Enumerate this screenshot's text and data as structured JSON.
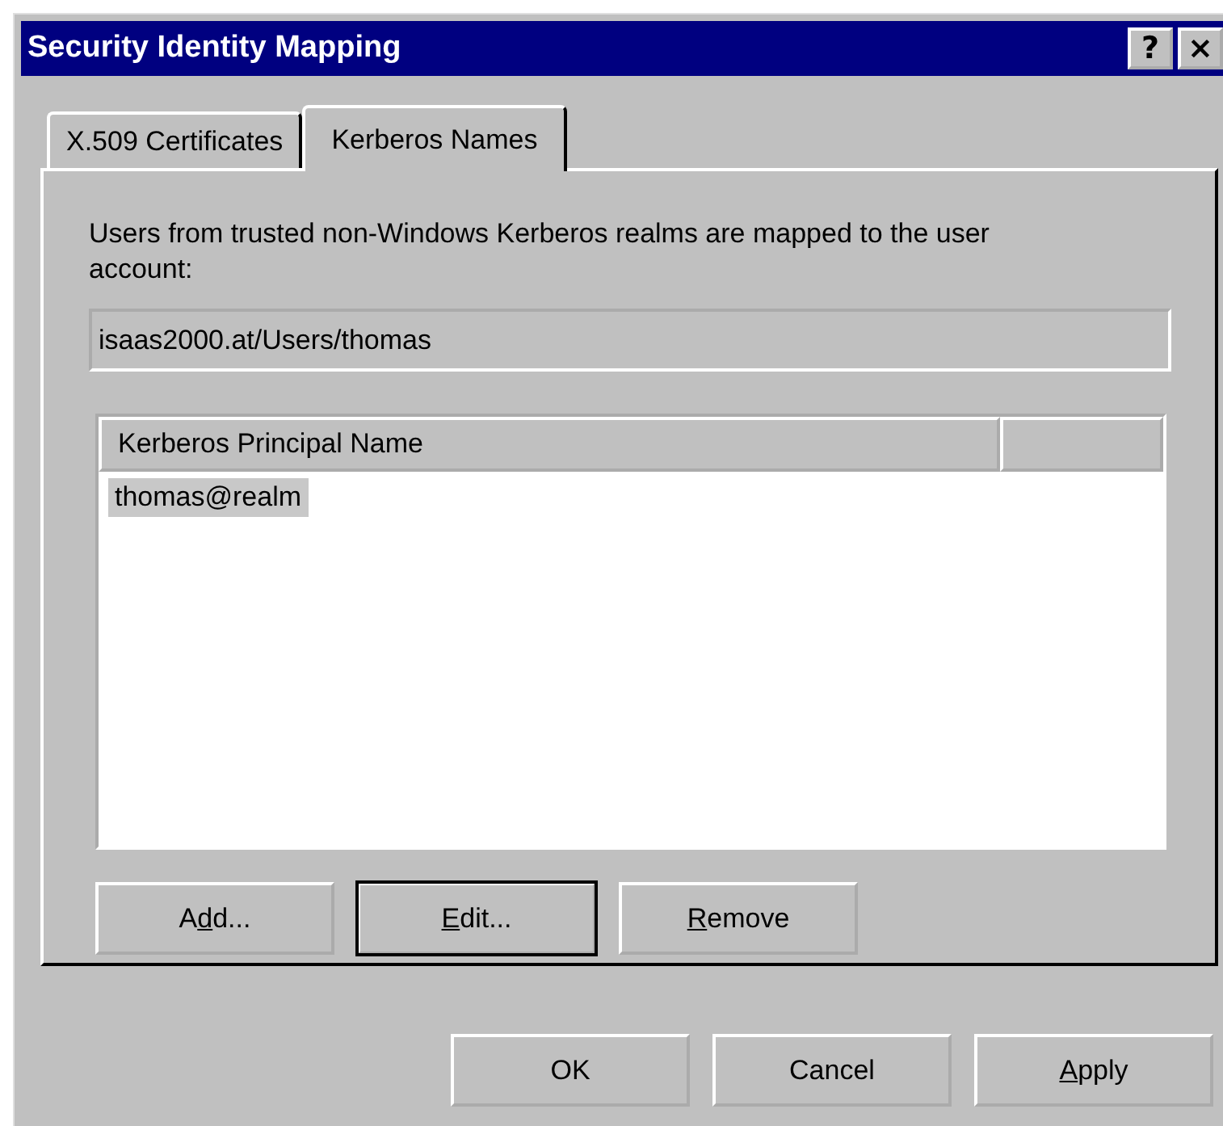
{
  "window": {
    "title": "Security Identity Mapping"
  },
  "title_buttons": [
    {
      "label": "?",
      "kind": "help"
    },
    {
      "label": "×",
      "kind": "close"
    }
  ],
  "tabs": [
    {
      "label": "X.509 Certificates",
      "selected": false
    },
    {
      "label": "Kerberos Names",
      "selected": true
    }
  ],
  "description": "Users from trusted non-Windows Kerberos realms are mapped to the user account:",
  "account_field": {
    "value": "isaas2000.at/Users/thomas"
  },
  "list": {
    "columns": [
      "Kerberos Principal Name"
    ],
    "rows": [
      {
        "name": "thomas@realm",
        "selected": true
      }
    ]
  },
  "list_buttons": [
    {
      "before": "A",
      "access_key": "d",
      "after": "d...",
      "default": false
    },
    {
      "access_key": "E",
      "after": "dit...",
      "default": true
    },
    {
      "access_key": "R",
      "after": "emove",
      "default": false
    }
  ],
  "dialog_buttons": [
    {
      "before": "OK",
      "default": false
    },
    {
      "before": "Cancel",
      "default": false
    },
    {
      "access_key": "A",
      "after": "pply",
      "default": false
    }
  ]
}
